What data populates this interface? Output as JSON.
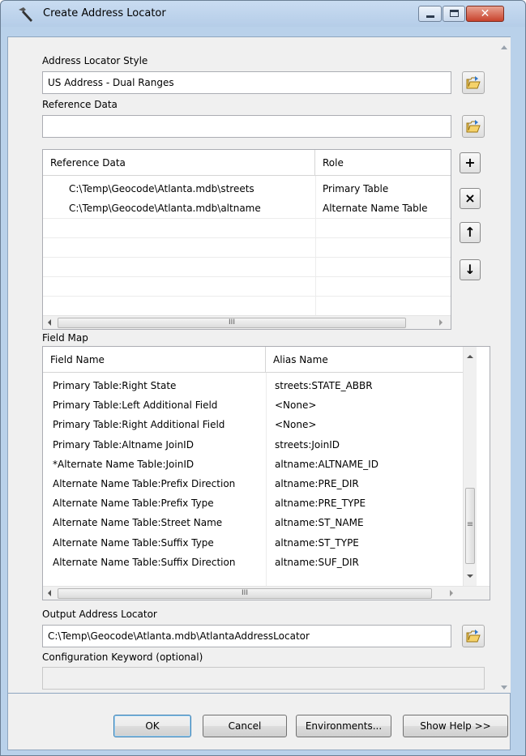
{
  "window": {
    "title": "Create Address Locator"
  },
  "locator_style": {
    "label": "Address Locator Style",
    "value": "US Address - Dual Ranges"
  },
  "reference_data": {
    "label": "Reference Data",
    "value": ""
  },
  "ref_table": {
    "col_data": "Reference Data",
    "col_role": "Role",
    "rows": [
      {
        "data": "C:\\Temp\\Geocode\\Atlanta.mdb\\streets",
        "role": "Primary Table"
      },
      {
        "data": "C:\\Temp\\Geocode\\Atlanta.mdb\\altname",
        "role": "Alternate Name Table"
      }
    ],
    "hscroll_glyph": "III"
  },
  "side_buttons": {
    "add": "+",
    "remove": "×",
    "up": "↑",
    "down": "↓"
  },
  "field_map": {
    "label": "Field Map",
    "col_field": "Field Name",
    "col_alias": "Alias Name",
    "rows": [
      {
        "field": "Primary Table:Right State",
        "alias": "streets:STATE_ABBR"
      },
      {
        "field": "Primary Table:Left Additional Field",
        "alias": "<None>"
      },
      {
        "field": "Primary Table:Right Additional Field",
        "alias": "<None>"
      },
      {
        "field": "Primary Table:Altname JoinID",
        "alias": "streets:JoinID"
      },
      {
        "field": "*Alternate Name Table:JoinID",
        "alias": "altname:ALTNAME_ID"
      },
      {
        "field": "Alternate Name Table:Prefix Direction",
        "alias": "altname:PRE_DIR"
      },
      {
        "field": "Alternate Name Table:Prefix Type",
        "alias": "altname:PRE_TYPE"
      },
      {
        "field": "Alternate Name Table:Street Name",
        "alias": "altname:ST_NAME"
      },
      {
        "field": "Alternate Name Table:Suffix Type",
        "alias": "altname:ST_TYPE"
      },
      {
        "field": "Alternate Name Table:Suffix Direction",
        "alias": "altname:SUF_DIR"
      }
    ],
    "hscroll_glyph": "III",
    "vscroll_glyph": "≡"
  },
  "output": {
    "label": "Output Address Locator",
    "value": "C:\\Temp\\Geocode\\Atlanta.mdb\\AtlantaAddressLocator"
  },
  "config": {
    "label": "Configuration Keyword (optional)",
    "value": ""
  },
  "buttons": {
    "ok": "OK",
    "cancel": "Cancel",
    "environments": "Environments...",
    "help": "Show Help >>"
  },
  "window_controls": {
    "close": "✕"
  }
}
